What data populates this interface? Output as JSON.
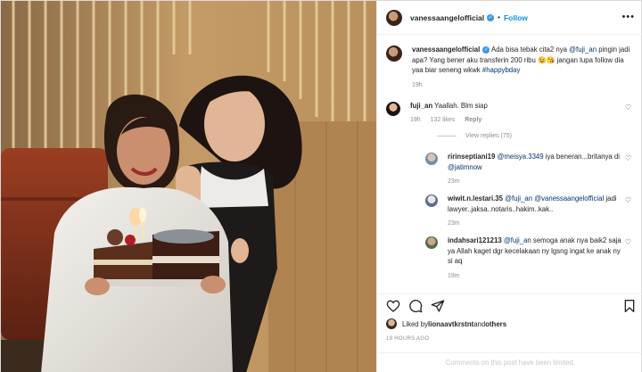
{
  "post": {
    "username": "vanessaangelofficial",
    "follow_label": "Follow",
    "separator": "•",
    "more_label": "•••"
  },
  "caption": {
    "username": "vanessaangelofficial",
    "text_1": " Ada bisa tebak cita2 nya ",
    "mention": "@fuji_an",
    "text_2": " pingin jadi apa? Yang bener aku transferin 200 ribu 😉😘 jangan lupa follow dia yaa biar seneng wkwk ",
    "hashtag": "#happybday",
    "time": "19h"
  },
  "comments": [
    {
      "username": "fuji_an",
      "text": " Yaallah. Blm siap",
      "time": "19h",
      "likes": "132 likes",
      "reply_label": "Reply"
    }
  ],
  "view_replies": "View replies (75)",
  "replies": [
    {
      "username": "ririnseptiani19",
      "mention": "@meisya.3349",
      "text": " iya beneran...britanya di ",
      "mention_2": "@jatimnow",
      "text_2": "",
      "time": "23m"
    },
    {
      "username": "wiwit.n.lestari.35",
      "mention": "@fuji_an",
      "text": " ",
      "mention_2": "@vanessaangelofficial",
      "text_2": " jadi lawyer..jaksa..notaris..hakim..kak..",
      "time": "23m"
    },
    {
      "username": "indahsari121213",
      "mention": "@fuji_an",
      "text": " semoga anak nya baik2 saja ya Allah kaget dgr kecelakaan ny lgsng ingat ke anak ny si aq",
      "mention_2": "",
      "text_2": "",
      "time": "19m"
    }
  ],
  "likes": {
    "prefix": "Liked by ",
    "user": "lionaavtkrstnt",
    "joiner": " and ",
    "others": "others"
  },
  "timestamp": "19 HOURS AGO",
  "comments_limited": "Comments on this post have been limited.",
  "icons": {
    "heart": "heart-icon",
    "comment": "comment-icon",
    "share": "share-icon",
    "save": "bookmark-icon"
  },
  "colors": {
    "link": "#00376b",
    "follow": "#0095f6",
    "muted": "#8e8e8e"
  }
}
